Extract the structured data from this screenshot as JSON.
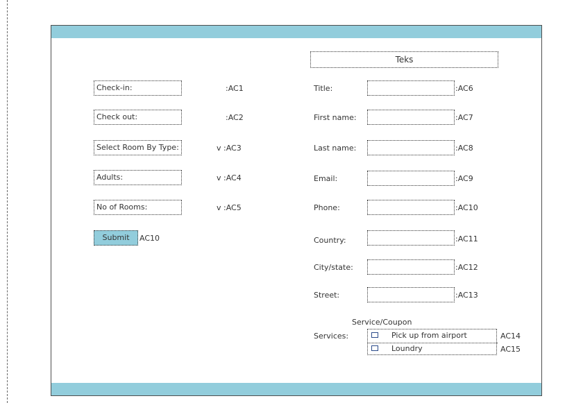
{
  "header": {
    "teks": "Teks"
  },
  "left_form": {
    "fields": [
      {
        "label": "Check-in:",
        "code": ":AC1",
        "dropdown": ""
      },
      {
        "label": "Check out:",
        "code": ":AC2",
        "dropdown": ""
      },
      {
        "label": "Select Room By Type:",
        "code": ":AC3",
        "dropdown": "v"
      },
      {
        "label": "Adults:",
        "code": ":AC4",
        "dropdown": "v"
      },
      {
        "label": "No of Rooms:",
        "code": ":AC5",
        "dropdown": "v"
      }
    ],
    "submit_label": "Submit",
    "submit_code": "AC10"
  },
  "right_form": {
    "fields": [
      {
        "label": "Title:",
        "code": ":AC6"
      },
      {
        "label": "First name:",
        "code": ":AC7"
      },
      {
        "label": "Last name:",
        "code": ":AC8"
      },
      {
        "label": "Email:",
        "code": ":AC9"
      },
      {
        "label": "Phone:",
        "code": ":AC10"
      },
      {
        "label": "Country:",
        "code": ":AC11"
      },
      {
        "label": "City/state:",
        "code": ":AC12"
      },
      {
        "label": "Street:",
        "code": ":AC13"
      }
    ],
    "services_heading": "Service/Coupon",
    "services_label": "Services:",
    "services": [
      {
        "label": "Pick up from airport",
        "code": "AC14"
      },
      {
        "label": "Loundry",
        "code": "AC15"
      }
    ]
  },
  "colors": {
    "bar": "#92cddc",
    "border": "#4d4d4d"
  }
}
